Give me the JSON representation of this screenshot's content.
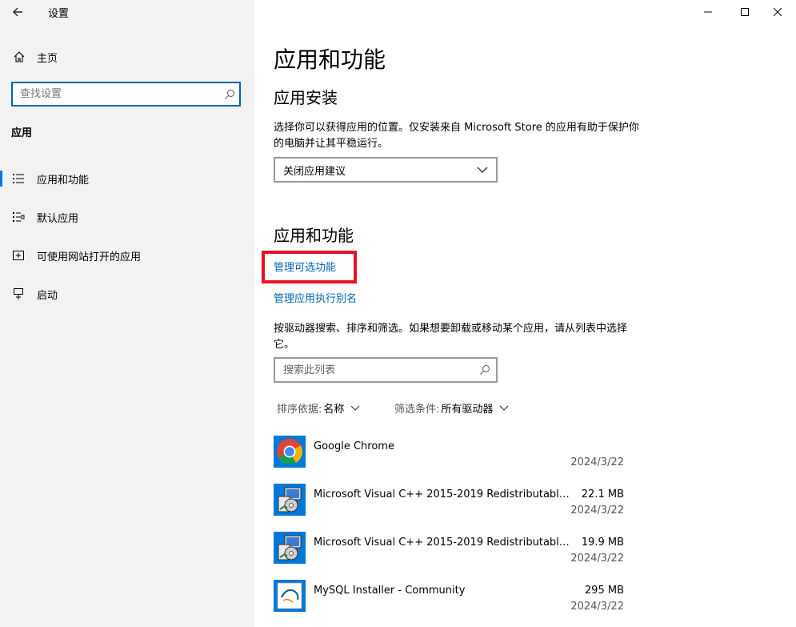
{
  "window": {
    "title": "设置"
  },
  "sidebar": {
    "home_label": "主页",
    "search_placeholder": "查找设置",
    "category": "应用",
    "items": [
      {
        "label": "应用和功能",
        "icon": "apps-features-icon",
        "selected": true
      },
      {
        "label": "默认应用",
        "icon": "default-apps-icon",
        "selected": false
      },
      {
        "label": "可使用网站打开的应用",
        "icon": "apps-for-websites-icon",
        "selected": false
      },
      {
        "label": "启动",
        "icon": "startup-icon",
        "selected": false
      }
    ]
  },
  "main": {
    "page_title": "应用和功能",
    "install_section": {
      "title": "应用安装",
      "description": "选择你可以获得应用的位置。仅安装来自 Microsoft Store 的应用有助于保护你的电脑并让其平稳运行。",
      "dropdown_value": "关闭应用建议"
    },
    "features_section": {
      "title": "应用和功能",
      "link_optional": "管理可选功能",
      "link_alias": "管理应用执行别名",
      "description": "按驱动器搜索、排序和筛选。如果想要卸载或移动某个应用，请从列表中选择它。",
      "search_placeholder": "搜索此列表",
      "sort_key": "排序依据:",
      "sort_value": "名称",
      "filter_key": "筛选条件:",
      "filter_value": "所有驱动器"
    },
    "apps": [
      {
        "name": "Google Chrome",
        "size": "",
        "date": "2024/3/22",
        "icon": "chrome-icon"
      },
      {
        "name": "Microsoft Visual C++ 2015-2019 Redistributable (...",
        "size": "22.1 MB",
        "date": "2024/3/22",
        "icon": "installer-icon"
      },
      {
        "name": "Microsoft Visual C++ 2015-2019 Redistributable (...",
        "size": "19.9 MB",
        "date": "2024/3/22",
        "icon": "installer-icon"
      },
      {
        "name": "MySQL Installer - Community",
        "size": "295 MB",
        "date": "2024/3/22",
        "icon": "mysql-installer-icon"
      }
    ]
  },
  "colors": {
    "accent": "#0078d7",
    "link": "#0063b1",
    "highlight": "#e81123",
    "sidebar_bg": "#f2f2f2"
  }
}
